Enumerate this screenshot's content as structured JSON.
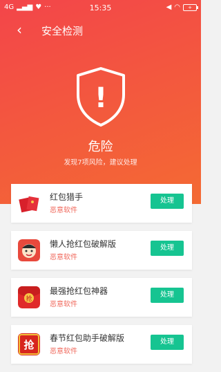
{
  "status_bar": {
    "network": "4G",
    "time": "15:35",
    "battery": "+"
  },
  "header": {
    "back_icon": "chevron-left",
    "title": "安全检测"
  },
  "result": {
    "shield_symbol": "!",
    "status": "危险",
    "summary": "发现7项风险，建议处理"
  },
  "threats": [
    {
      "name": "红包猎手",
      "type": "恶意软件",
      "action": "处理",
      "icon": "red-envelopes-icon"
    },
    {
      "name": "懒人抢红包破解版",
      "type": "恶意软件",
      "action": "处理",
      "icon": "lazy-face-icon"
    },
    {
      "name": "最强抢红包神器",
      "type": "恶意软件",
      "action": "处理",
      "icon": "grab-badge-icon"
    },
    {
      "name": "春节红包助手破解版",
      "type": "恶意软件",
      "action": "处理",
      "icon": "grab-envelope-icon"
    }
  ],
  "colors": {
    "header_gradient_start": "#f3454a",
    "header_gradient_end": "#f46a33",
    "action_button": "#16c491",
    "threat_type_text": "#f0695c"
  }
}
